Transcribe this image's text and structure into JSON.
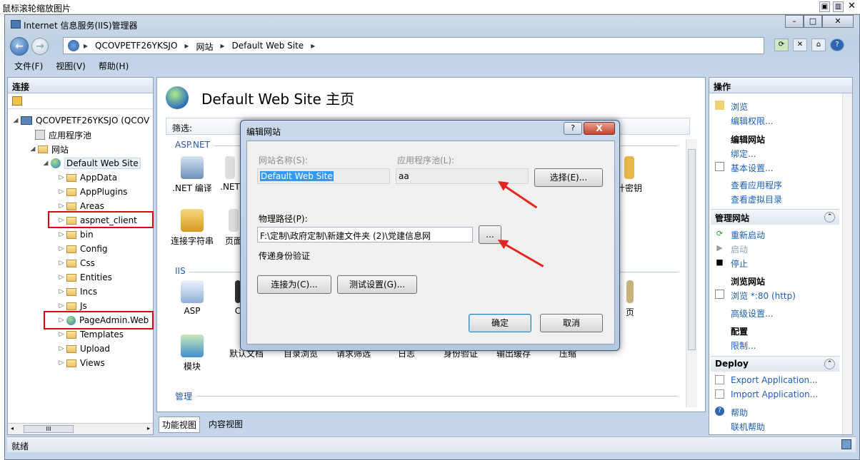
{
  "viewer": {
    "title": "鼠标滚轮缩放图片"
  },
  "window": {
    "title": "Internet 信息服务(IIS)管理器"
  },
  "address": {
    "crumbs": [
      "QCOVPETF26YKSJO",
      "网站",
      "Default Web Site"
    ]
  },
  "menu": {
    "items": [
      "文件(F)",
      "视图(V)",
      "帮助(H)"
    ]
  },
  "connections": {
    "title": "连接",
    "tree": {
      "server": "QCOVPETF26YKSJO (QCOV",
      "app_pools": "应用程序池",
      "sites": "网站",
      "site": "Default Web Site",
      "folders": [
        "AppData",
        "AppPlugins",
        "Areas",
        "aspnet_client",
        "bin",
        "Config",
        "Css",
        "Entities",
        "Incs",
        "Js",
        "PageAdmin.Web",
        "Templates",
        "Upload",
        "Views"
      ]
    },
    "scroll_thumb": "III"
  },
  "center": {
    "title": "Default Web Site 主页",
    "filter_label": "筛选:",
    "sections": {
      "aspnet": "ASP.NET",
      "iis": "IIS",
      "manage": "管理"
    },
    "aspnet_features": [
      ".NET 编译",
      ".NET",
      "连接字符串",
      "页面",
      "计密钥"
    ],
    "iis_features": [
      "ASP",
      "C",
      "页"
    ],
    "iis_row2": [
      "模块",
      "默认文档",
      "目录浏览",
      "请求筛选",
      "日志",
      "身份验证",
      "输出缓存",
      "压缩"
    ],
    "tabs": {
      "features": "功能视图",
      "content": "内容视图"
    }
  },
  "actions": {
    "title": "操作",
    "browse": "浏览",
    "edit_perms": "编辑权限...",
    "edit_site_h": "编辑网站",
    "bindings": "绑定...",
    "basic_settings": "基本设置...",
    "view_apps": "查看应用程序",
    "view_vdirs": "查看虚拟目录",
    "manage_group": "管理网站",
    "restart": "重新启动",
    "start": "启动",
    "stop": "停止",
    "browse_site_h": "浏览网站",
    "browse_80": "浏览 *:80 (http)",
    "advanced": "高级设置...",
    "config_h": "配置",
    "limits": "限制...",
    "deploy_group": "Deploy",
    "export_app": "Export Application...",
    "import_app": "Import Application...",
    "help": "帮助",
    "online_help": "联机帮助"
  },
  "status": {
    "text": "就绪"
  },
  "dialog": {
    "title": "编辑网站",
    "help_btn": "?",
    "close_btn": "X",
    "site_name_label": "网站名称(S):",
    "site_name_value": "Default Web Site",
    "app_pool_label": "应用程序池(L):",
    "app_pool_value": "aa",
    "select_btn": "选择(E)...",
    "phys_path_label": "物理路径(P):",
    "phys_path_value": "F:\\定制\\政府定制\\新建文件夹 (2)\\党建信息网",
    "browse_btn": "...",
    "passthrough_label": "传递身份验证",
    "connect_as_btn": "连接为(C)...",
    "test_settings_btn": "测试设置(G)...",
    "ok_btn": "确定",
    "cancel_btn": "取消"
  },
  "colors": {
    "annotation_red": "#d6000f",
    "link_blue": "#1d5eb5"
  }
}
